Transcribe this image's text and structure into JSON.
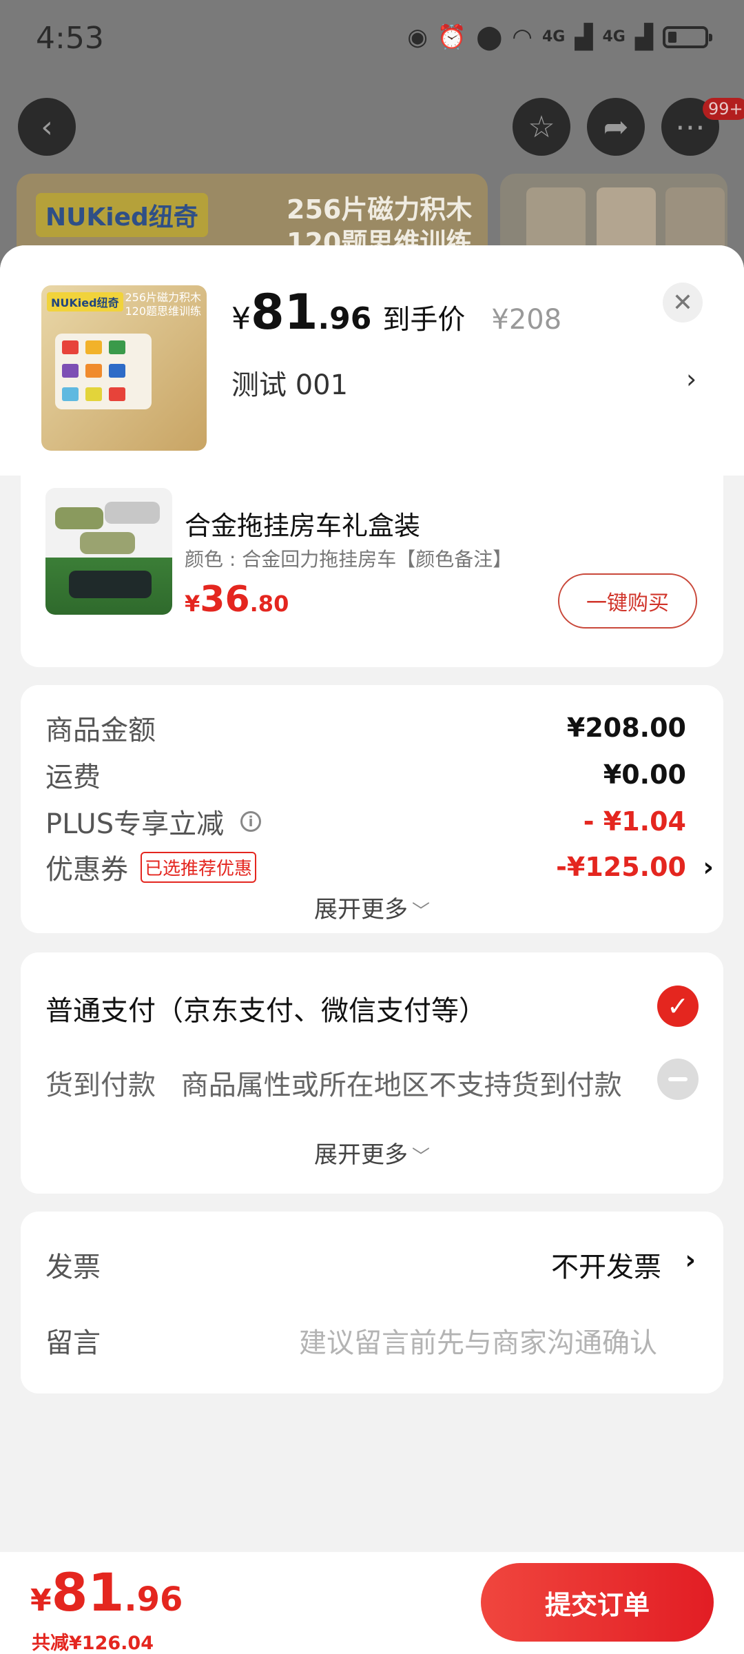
{
  "status_bar": {
    "time": "4:53",
    "network_1": "4G",
    "network_2": "4G"
  },
  "background_page": {
    "notification_badge": "99+",
    "banner_brand": "NUKied纽奇",
    "banner_line1": "256片磁力积木",
    "banner_line2": "120题思维训练"
  },
  "product": {
    "thumb_logo": "NUKied纽奇",
    "thumb_caption_1": "256片磁力积木",
    "thumb_caption_2": "120题思维训练",
    "currency": "¥",
    "price_int": "81",
    "price_dec": ".96",
    "price_tag": "到手价",
    "original_price": "¥208",
    "spec": "测试  001"
  },
  "addon": {
    "title": "合金拖挂房车礼盒装",
    "subtitle": "颜色 : 合金回力拖挂房车【颜色备注】",
    "currency": "¥",
    "price_int": "36",
    "price_dec": ".80",
    "buy_label": "一键购买"
  },
  "fees": {
    "goods_label": "商品金额",
    "goods_value": "¥208.00",
    "shipping_label": "运费",
    "shipping_value": "¥0.00",
    "plus_label": "PLUS专享立减",
    "plus_value": "- ¥1.04",
    "coupon_label": "优惠券",
    "coupon_tag": "已选推荐优惠",
    "coupon_value": "-¥125.00",
    "expand_label": "展开更多"
  },
  "payment": {
    "normal_label": "普通支付（京东支付、微信支付等）",
    "cod_label": "货到付款",
    "cod_note": "商品属性或所在地区不支持货到付款",
    "expand_label": "展开更多"
  },
  "misc": {
    "invoice_label": "发票",
    "invoice_value": "不开发票",
    "message_label": "留言",
    "message_placeholder": "建议留言前先与商家沟通确认"
  },
  "footer": {
    "currency": "¥",
    "total_int": "81",
    "total_dec": ".96",
    "saved": "共减¥126.04",
    "submit_label": "提交订单"
  },
  "colors": {
    "accent_red": "#e4261f",
    "background": "#f2f2f2"
  }
}
